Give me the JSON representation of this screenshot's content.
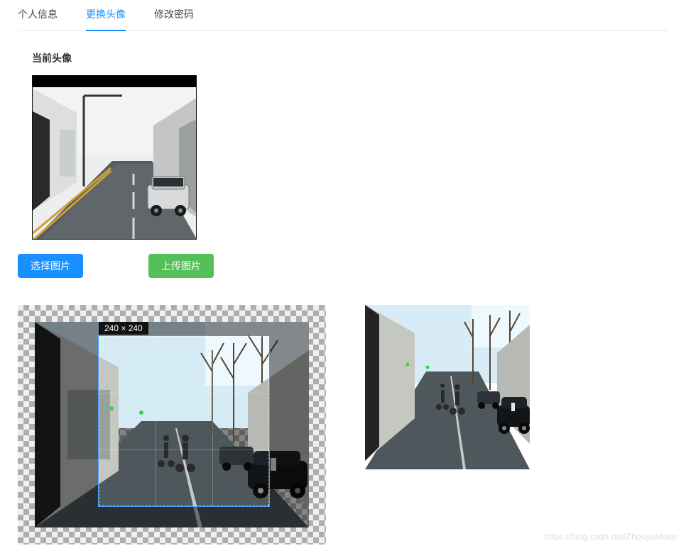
{
  "tabs": [
    {
      "id": "profile",
      "label": "个人信息",
      "active": false
    },
    {
      "id": "avatar",
      "label": "更换头像",
      "active": true
    },
    {
      "id": "password",
      "label": "修改密码",
      "active": false
    }
  ],
  "section": {
    "heading": "当前头像"
  },
  "buttons": {
    "select_label": "选择图片",
    "upload_label": "上传图片"
  },
  "cropper": {
    "size_label": "240 × 240"
  },
  "watermark": "https://blog.csdn.net/Zhouyunfeier"
}
